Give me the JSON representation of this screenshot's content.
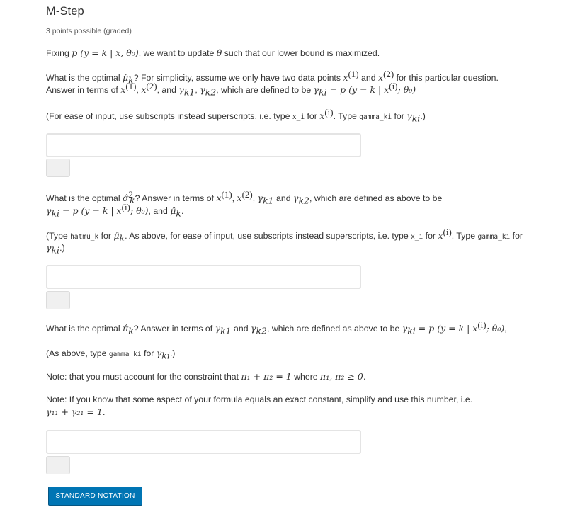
{
  "problem": {
    "title": "M-Step",
    "points": "3 points possible (graded)",
    "intro": {
      "prefix": "Fixing ",
      "formula": "p (y = k | x, θ₀)",
      "middle": ", we want to update ",
      "theta": "θ",
      "suffix": " such that our lower bound is maximized."
    }
  },
  "q1": {
    "line1_a": "What is the optimal ",
    "var": "μ̂",
    "var_sub": "k",
    "line1_b": "? For simplicity, assume we only have two data points ",
    "line1_c": " and ",
    "line1_d": " for this particular question.",
    "line2_a": "Answer in terms of ",
    "line2_b": ", and ",
    "line2_c": ", which are defined to be ",
    "hint_a": "(For ease of input, use subscripts instead superscripts, i.e. type ",
    "hint_code1": "x_i",
    "hint_b": " for ",
    "hint_c": ". Type ",
    "hint_code2": "gamma_ki",
    "hint_d": " for ",
    "hint_e": ".)",
    "input_value": "",
    "submit_label": ""
  },
  "q2": {
    "line1_a": "What is the optimal ",
    "var": "σ̂",
    "line1_b": "? Answer in terms of ",
    "line1_c": " and ",
    "line1_d": ", which are defined as above to be",
    "line2_a": ", and ",
    "line2_b": ".",
    "hint_a": "(Type ",
    "hint_code0": "hatmu_k",
    "hint_b": " for ",
    "hint_c": ". As above, for ease of input, use subscripts instead superscripts, i.e. type ",
    "hint_code1": "x_i",
    "hint_d": " for ",
    "hint_e": ". Type ",
    "hint_code2": "gamma_ki",
    "hint_f": " for",
    "hint_g": ".)",
    "input_value": "",
    "submit_label": ""
  },
  "q3": {
    "line1_a": "What is the optimal ",
    "var": "π̂",
    "line1_b": "? Answer in terms of ",
    "line1_c": " and ",
    "line1_d": ", which are defined as above to be ",
    "line1_e": ",",
    "hint_a": "(As above, type ",
    "hint_code": "gamma_ki",
    "hint_b": " for ",
    "hint_c": ".)",
    "note1_a": "Note: that you must account for the constraint that ",
    "note1_f1": "π₁ + π₂ = 1",
    "note1_b": " where ",
    "note1_f2": "π₁, π₂ ≥ 0.",
    "note2_a": "Note: If you know that some aspect of your formula equals an exact constant, simplify and use this number, i.e.",
    "note2_f": "γ₁₁ + γ₂₁ = 1.",
    "input_value": "",
    "submit_label": ""
  },
  "math": {
    "x1": "x",
    "x1_sup": "(1)",
    "x2": "x",
    "x2_sup": "(2)",
    "xi_sup": "(i)",
    "gamma_k1": "γ",
    "gamma_k1_sub": "k1",
    "gamma_k2_sub": "k2",
    "gamma_ki_sub": "ki",
    "def_rhs": " = p (y = k | x",
    "def_tail": "; θ₀)"
  },
  "footer": {
    "standard_notation_label": "STANDARD NOTATION"
  },
  "colors": {
    "accent": "#0075b4",
    "text": "#313131",
    "muted": "#5a5a5a",
    "input_border": "#e4e4e4",
    "submit_bg": "#f0f0f0"
  }
}
